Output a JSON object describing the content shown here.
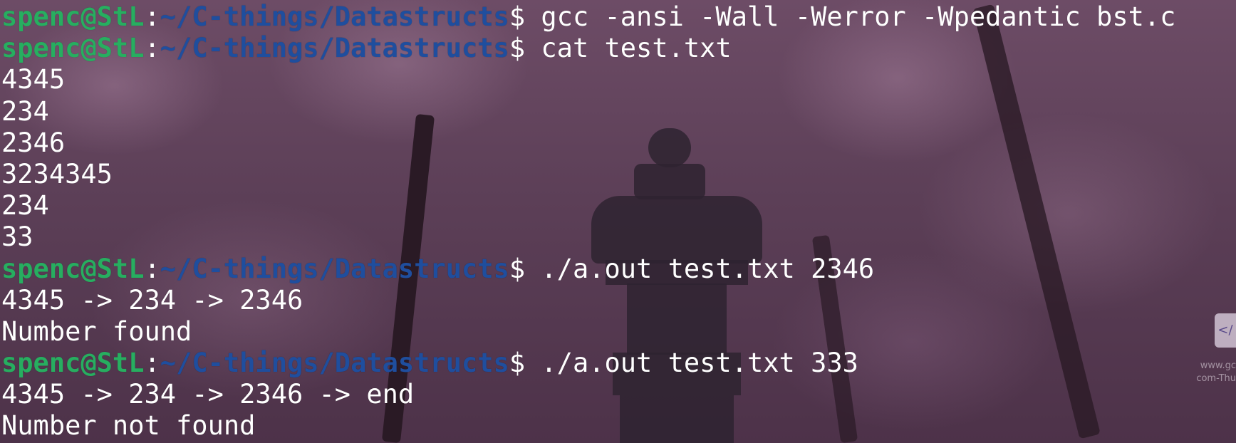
{
  "prompt": {
    "user_host": "spenc@StL",
    "separator": ":",
    "path": "~/C-things/Datastructs",
    "symbol": "$"
  },
  "lines": [
    {
      "type": "prompt",
      "command": " gcc -ansi -Wall -Werror -Wpedantic bst.c"
    },
    {
      "type": "prompt",
      "command": " cat test.txt"
    },
    {
      "type": "output",
      "text": "4345"
    },
    {
      "type": "output",
      "text": "234"
    },
    {
      "type": "output",
      "text": "2346"
    },
    {
      "type": "output",
      "text": "3234345"
    },
    {
      "type": "output",
      "text": "234"
    },
    {
      "type": "output",
      "text": "33"
    },
    {
      "type": "prompt",
      "command": " ./a.out test.txt 2346"
    },
    {
      "type": "output",
      "text": "4345 -> 234 -> 2346"
    },
    {
      "type": "output",
      "text": "Number found"
    },
    {
      "type": "prompt",
      "command": " ./a.out test.txt 333"
    },
    {
      "type": "output",
      "text": "4345 -> 234 -> 2346 -> end"
    },
    {
      "type": "output",
      "text": "Number not found"
    }
  ],
  "overlay": {
    "icon": "code-icon",
    "glyph": "</",
    "caption": "www.gc\ncom-Thu"
  },
  "colors": {
    "user_host": "#27ae60",
    "path": "#1f4e9e",
    "text": "#ffffff",
    "background": "#5c3f57"
  }
}
